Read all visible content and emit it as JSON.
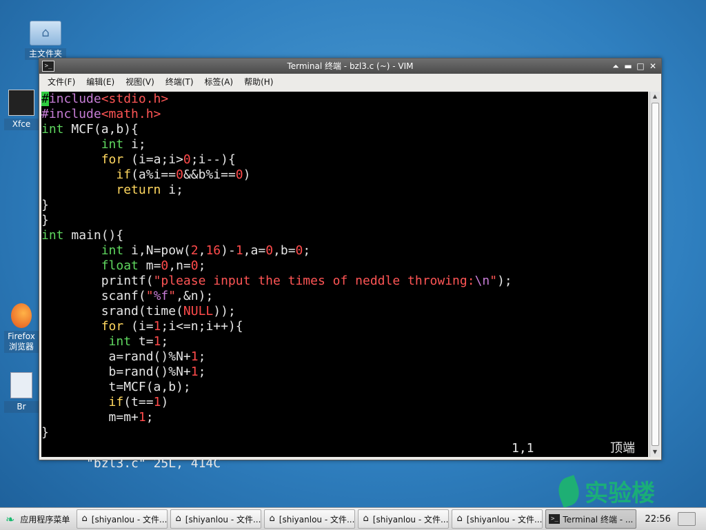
{
  "desktop": {
    "icons": [
      {
        "label": "主文件夹"
      },
      {
        "label": "Xfce"
      },
      {
        "label": "Firefox 浏览器"
      },
      {
        "label": "Br"
      }
    ]
  },
  "window": {
    "title": "Terminal 终端 - bzl3.c (~) - VIM",
    "controls": {
      "shade": "⏶",
      "minimize": "▬",
      "maximize": "□",
      "close": "✕"
    },
    "menu": [
      "文件(F)",
      "编辑(E)",
      "视图(V)",
      "终端(T)",
      "标签(A)",
      "帮助(H)"
    ]
  },
  "editor": {
    "lines": [
      [
        [
          "#",
          "cursor"
        ],
        [
          "include",
          "pre"
        ],
        [
          "<stdio.h>",
          "str"
        ]
      ],
      [
        [
          "#include",
          "pre"
        ],
        [
          "<math.h>",
          "str"
        ]
      ],
      [
        [
          "int",
          "type"
        ],
        [
          " MCF(a,b){",
          ""
        ]
      ],
      [
        [
          "        ",
          ""
        ],
        [
          "int",
          "type"
        ],
        [
          " i;",
          ""
        ]
      ],
      [
        [
          "        ",
          ""
        ],
        [
          "for",
          "stmt"
        ],
        [
          " (i=a;i>",
          ""
        ],
        [
          "0",
          "num"
        ],
        [
          ";i--){",
          ""
        ]
      ],
      [
        [
          "          ",
          ""
        ],
        [
          "if",
          "stmt"
        ],
        [
          "(a%i==",
          ""
        ],
        [
          "0",
          "num"
        ],
        [
          "&&b%i==",
          ""
        ],
        [
          "0",
          "num"
        ],
        [
          ")",
          ""
        ]
      ],
      [
        [
          "          ",
          ""
        ],
        [
          "return",
          "stmt"
        ],
        [
          " i;",
          ""
        ]
      ],
      [
        [
          "}",
          ""
        ]
      ],
      [
        [
          "}",
          ""
        ]
      ],
      [
        [
          "int",
          "type"
        ],
        [
          " main(){",
          ""
        ]
      ],
      [
        [
          "        ",
          ""
        ],
        [
          "int",
          "type"
        ],
        [
          " i,N=pow(",
          ""
        ],
        [
          "2",
          "num"
        ],
        [
          ",",
          ""
        ],
        [
          "16",
          "num"
        ],
        [
          ")-",
          ""
        ],
        [
          "1",
          "num"
        ],
        [
          ",a=",
          ""
        ],
        [
          "0",
          "num"
        ],
        [
          ",b=",
          ""
        ],
        [
          "0",
          "num"
        ],
        [
          ";",
          ""
        ]
      ],
      [
        [
          "        ",
          ""
        ],
        [
          "float",
          "type"
        ],
        [
          " m=",
          ""
        ],
        [
          "0",
          "num"
        ],
        [
          ",n=",
          ""
        ],
        [
          "0",
          "num"
        ],
        [
          ";",
          ""
        ]
      ],
      [
        [
          "        printf(",
          ""
        ],
        [
          "\"please input the times of neddle throwing:",
          "str"
        ],
        [
          "\\n",
          "sc"
        ],
        [
          "\"",
          "str"
        ],
        [
          ");",
          ""
        ]
      ],
      [
        [
          "        scanf(",
          ""
        ],
        [
          "\"",
          "str"
        ],
        [
          "%f",
          "sc"
        ],
        [
          "\"",
          "str"
        ],
        [
          ",&n);",
          ""
        ]
      ],
      [
        [
          "        srand(time(",
          ""
        ],
        [
          "NULL",
          "num"
        ],
        [
          "));",
          ""
        ]
      ],
      [
        [
          "        ",
          ""
        ],
        [
          "for",
          "stmt"
        ],
        [
          " (i=",
          ""
        ],
        [
          "1",
          "num"
        ],
        [
          ";i<=n;i++){",
          ""
        ]
      ],
      [
        [
          "         ",
          ""
        ],
        [
          "int",
          "type"
        ],
        [
          " t=",
          ""
        ],
        [
          "1",
          "num"
        ],
        [
          ";",
          ""
        ]
      ],
      [
        [
          "         a=rand()%N+",
          ""
        ],
        [
          "1",
          "num"
        ],
        [
          ";",
          ""
        ]
      ],
      [
        [
          "         b=rand()%N+",
          ""
        ],
        [
          "1",
          "num"
        ],
        [
          ";",
          ""
        ]
      ],
      [
        [
          "         t=MCF(a,b);",
          ""
        ]
      ],
      [
        [
          "         ",
          ""
        ],
        [
          "if",
          "stmt"
        ],
        [
          "(t==",
          ""
        ],
        [
          "1",
          "num"
        ],
        [
          ")",
          ""
        ]
      ],
      [
        [
          "         m=m+",
          ""
        ],
        [
          "1",
          "num"
        ],
        [
          ";",
          ""
        ]
      ],
      [
        [
          "}",
          ""
        ]
      ]
    ],
    "status": {
      "file_info": "\"bzl3.c\" 25L, 414C",
      "position": "1,1",
      "scroll": "顶端"
    }
  },
  "watermark": {
    "text": "实验楼"
  },
  "taskbar": {
    "start_label": "应用程序菜单",
    "tasks": [
      {
        "label": "[shiyanlou - 文件...",
        "icon": "folder-icon",
        "active": false
      },
      {
        "label": "[shiyanlou - 文件...",
        "icon": "folder-icon",
        "active": false
      },
      {
        "label": "[shiyanlou - 文件...",
        "icon": "folder-icon",
        "active": false
      },
      {
        "label": "[shiyanlou - 文件...",
        "icon": "folder-icon",
        "active": false
      },
      {
        "label": "[shiyanlou - 文件...",
        "icon": "folder-icon",
        "active": false
      },
      {
        "label": "Terminal 终端 - ...",
        "icon": "terminal-icon",
        "active": true
      }
    ],
    "clock": "22:56"
  },
  "colors": {
    "syntax_preproc": "#c67dd6",
    "syntax_string": "#ff5555",
    "syntax_type": "#5fd75f",
    "syntax_statement": "#ffd75f",
    "syntax_number": "#ff4b4b",
    "cursor": "#2ecc40"
  }
}
